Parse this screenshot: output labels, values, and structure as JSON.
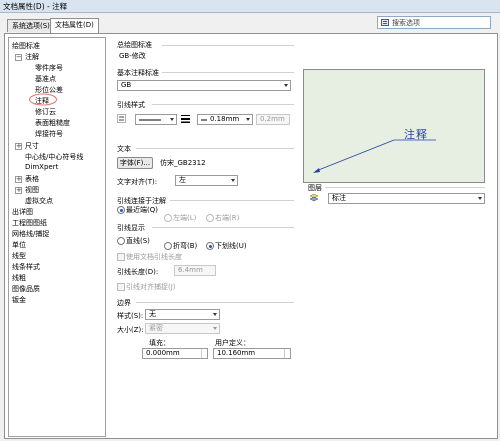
{
  "window": {
    "title": "文档属性(D) - 注释"
  },
  "tabs": [
    {
      "label": "系统选项(S)"
    },
    {
      "label": "文档属性(D)"
    }
  ],
  "search": {
    "placeholder": "搜索选项"
  },
  "tree": {
    "items": [
      "绘图标准",
      "注解",
      "零件序号",
      "基准点",
      "形位公差",
      "注释",
      "修订云",
      "表面粗糙度",
      "焊接符号",
      "尺寸",
      "中心线/中心符号线",
      "DimXpert",
      "表格",
      "视图",
      "虚拟交点",
      "出详图",
      "工程图图纸",
      "网格线/捕捉",
      "单位",
      "线型",
      "线条样式",
      "线粗",
      "图像品质",
      "钣金"
    ]
  },
  "overall_standard": {
    "label": "总绘图标准",
    "value": "GB-修改"
  },
  "base_standard": {
    "label": "基本注释标准",
    "value": "GB"
  },
  "leader_style": {
    "label": "引线样式",
    "weight": "0.18mm",
    "custom": "0.2mm"
  },
  "text": {
    "label": "文本",
    "font_button": "字体(F)...",
    "font_name": "仿宋_GB2312",
    "align_label": "文字对齐(T):",
    "align_value": "左"
  },
  "leader_attach": {
    "label": "引线连接于注解",
    "options": [
      "最近端(Q)",
      "左端(L)",
      "右端(R)"
    ]
  },
  "leader_display": {
    "label": "引线显示",
    "options": [
      "直线(S)",
      "折弯(B)",
      "下划线(U)"
    ],
    "use_doc_length": "使用文档引线长度",
    "length_label": "引线长度(D):",
    "length_value": "6.4mm",
    "align_snap": "引线对齐捕捉(J)"
  },
  "border": {
    "label": "边界",
    "style_label": "样式(S):",
    "style_value": "无",
    "size_label": "大小(Z):",
    "size_value": "紧密",
    "padding_label": "填充：",
    "padding_value": "0.000mm",
    "user_label": "用户定义：",
    "user_value": "10.160mm"
  },
  "preview": {
    "note_text": "注释"
  },
  "layer": {
    "label": "图层",
    "value": "标注"
  }
}
